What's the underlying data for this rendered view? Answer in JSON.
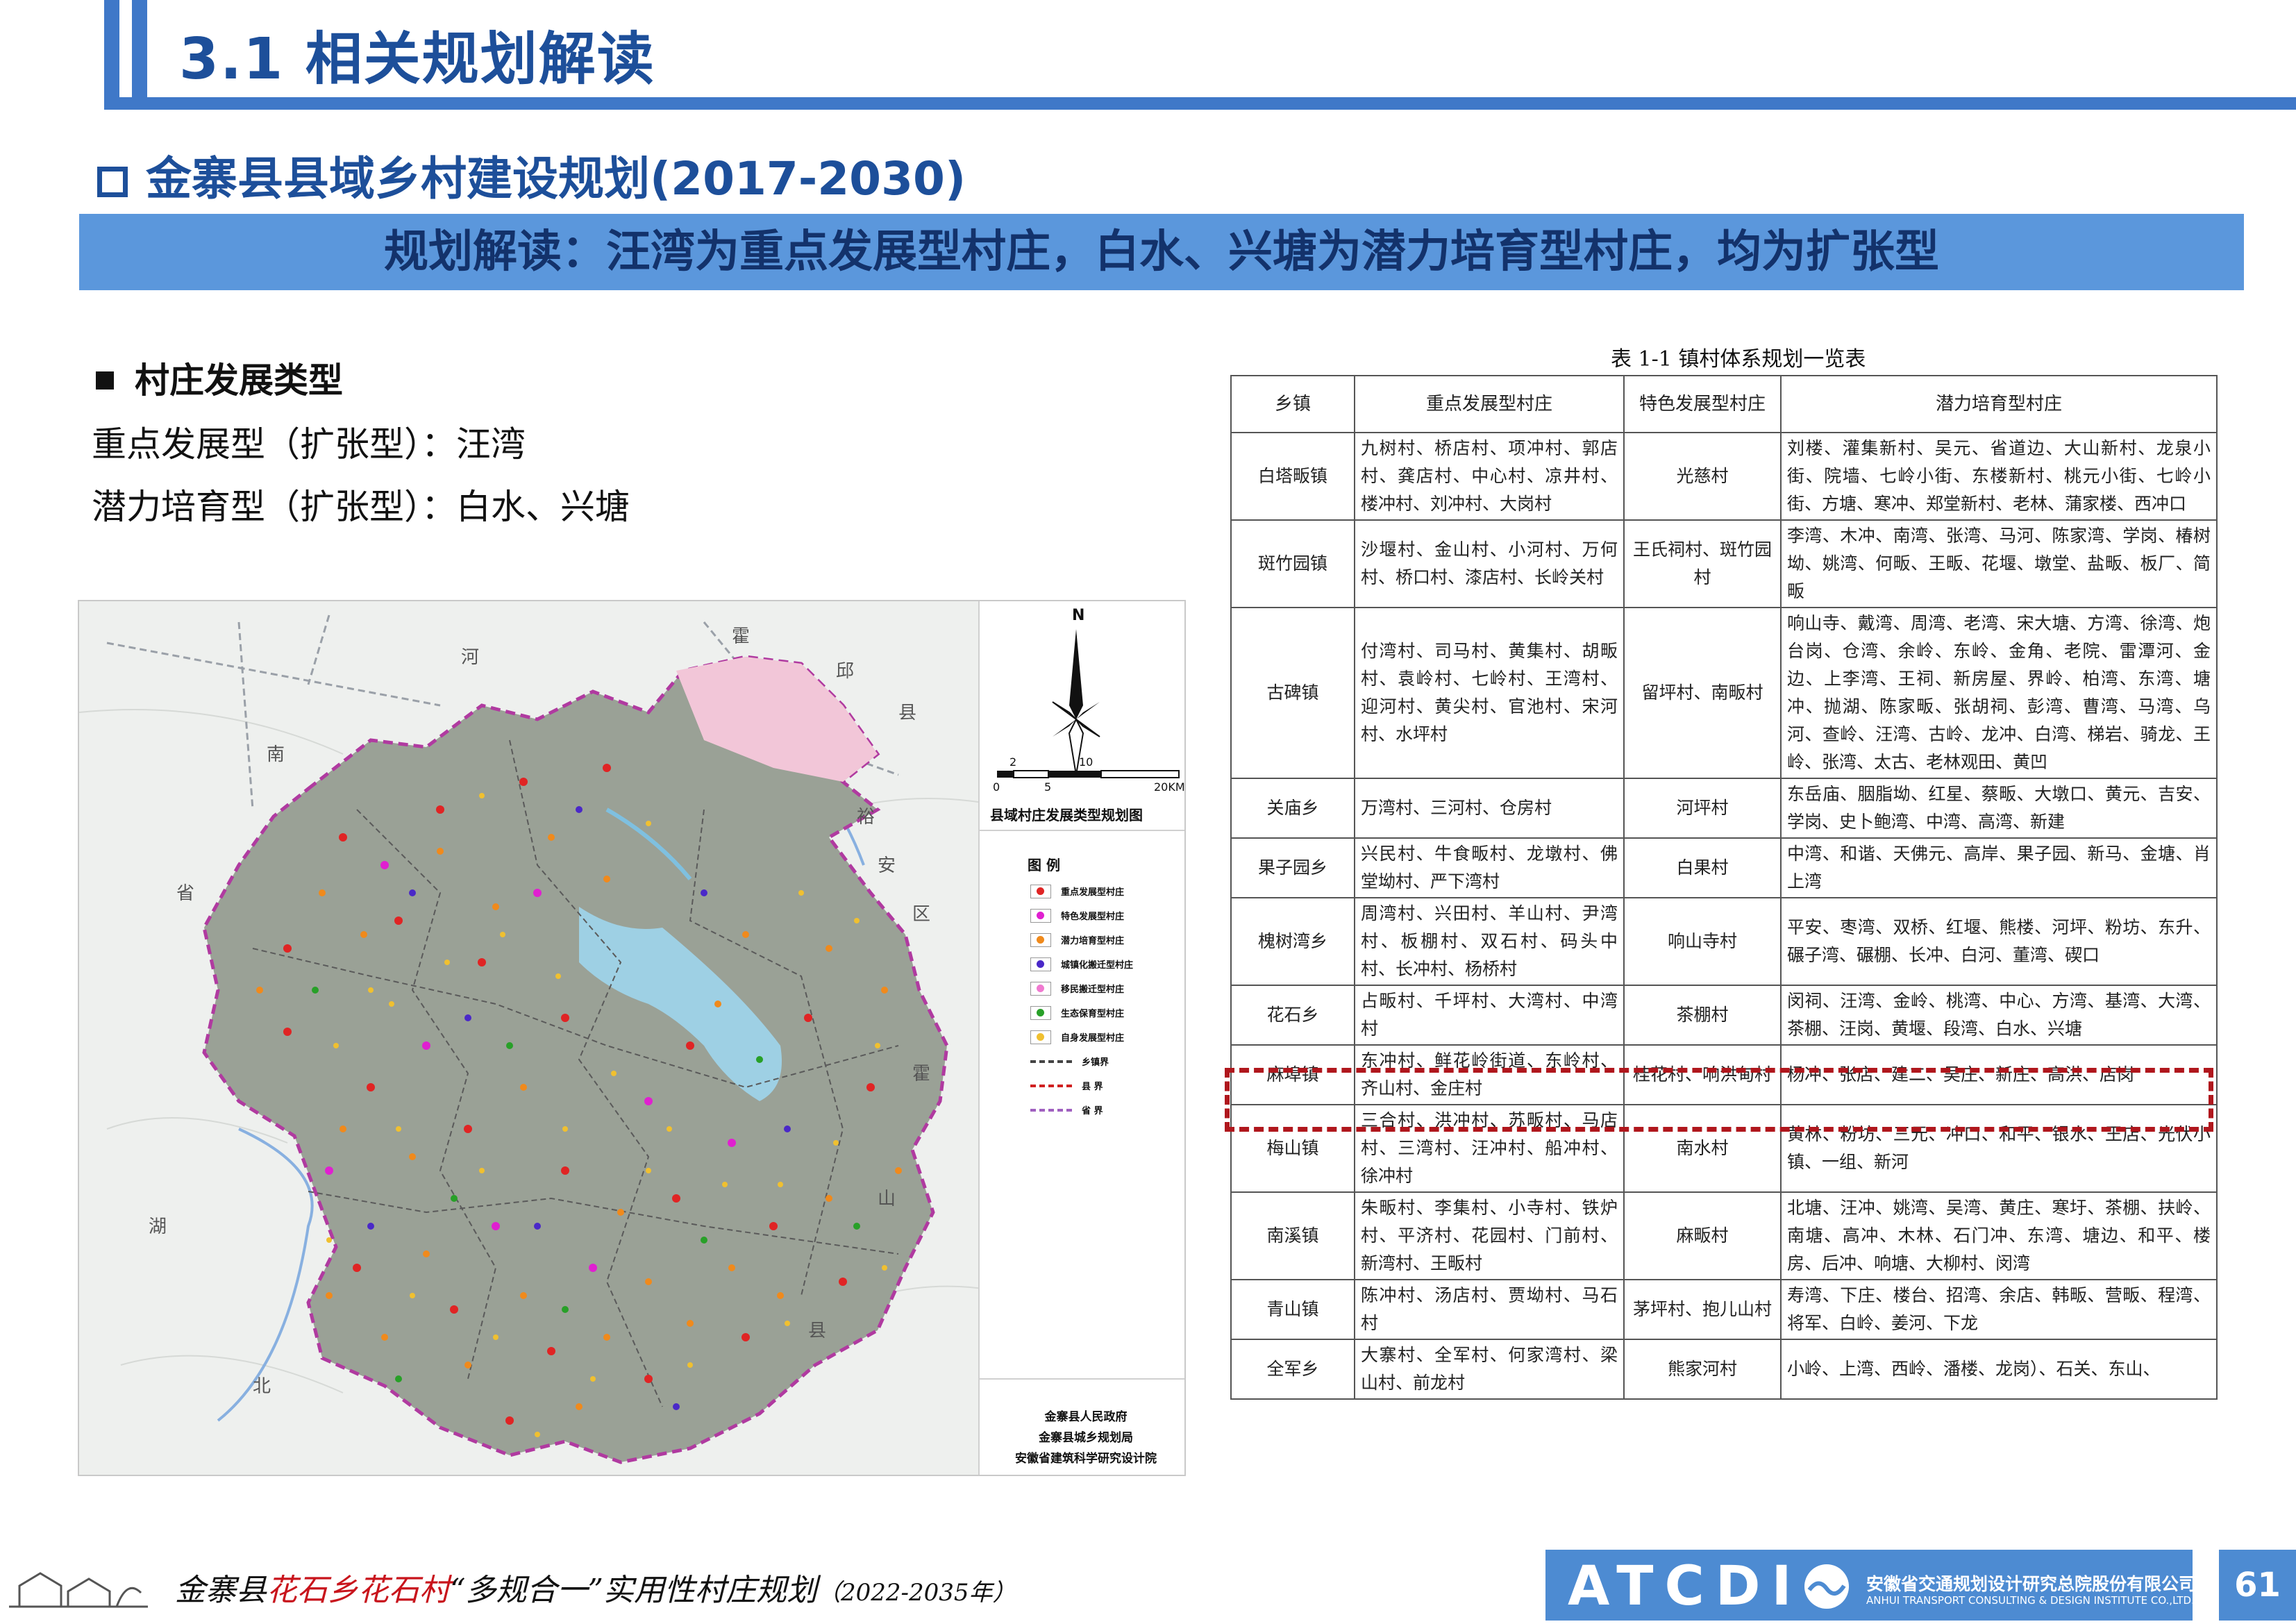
{
  "header": {
    "title": "3.1 相关规划解读"
  },
  "section": {
    "title": "金寨县县域乡村建设规划(2017-2030)",
    "banner": "规划解读：汪湾为重点发展型村庄，白水、兴塘为潜力培育型村庄，均为扩张型"
  },
  "village_types": {
    "heading": "村庄发展类型",
    "line1": "重点发展型（扩张型）：汪湾",
    "line2": "潜力培育型（扩张型）：白水、兴塘"
  },
  "map": {
    "title": "县域村庄发展类型规划图",
    "north": "N",
    "scale": {
      "t2": "2",
      "t10": "10",
      "t0": "0",
      "t5": "5",
      "t20": "20KM"
    },
    "legend_title": "图  例",
    "legend": [
      {
        "label": "重点发展型村庄",
        "color": "#e02424",
        "kind": "dot"
      },
      {
        "label": "特色发展型村庄",
        "color": "#e020d0",
        "kind": "dot"
      },
      {
        "label": "潜力培育型村庄",
        "color": "#f08a1c",
        "kind": "dot"
      },
      {
        "label": "城镇化搬迁型村庄",
        "color": "#4a28c8",
        "kind": "dot"
      },
      {
        "label": "移民搬迁型村庄",
        "color": "#f07ad0",
        "kind": "dot"
      },
      {
        "label": "生态保育型村庄",
        "color": "#28a028",
        "kind": "dot"
      },
      {
        "label": "自身发展型村庄",
        "color": "#f0c030",
        "kind": "dot"
      },
      {
        "label": "乡镇界",
        "color": "#444444",
        "kind": "line"
      },
      {
        "label": "县  界",
        "color": "#d02020",
        "kind": "line"
      },
      {
        "label": "省  界",
        "color": "#a060c0",
        "kind": "line"
      }
    ],
    "labels": {
      "he": "河",
      "huo1": "霍",
      "qiu": "邱",
      "xian1": "县",
      "nan": "南",
      "yu": "裕",
      "an": "安",
      "qu": "区",
      "sheng": "省",
      "huo2": "霍",
      "shan": "山",
      "xian2": "县",
      "hu": "湖",
      "bei": "北"
    },
    "credits": [
      "金寨县人民政府",
      "金寨县城乡规划局",
      "安徽省建筑科学研究设计院"
    ]
  },
  "table": {
    "caption": "表 1-1 镇村体系规划一览表",
    "headers": [
      "乡镇",
      "重点发展型村庄",
      "特色发展型村庄",
      "潜力培育型村庄"
    ],
    "rows": [
      [
        "白塔畈镇",
        "九树村、桥店村、项冲村、郭店村、龚店村、中心村、凉井村、楼冲村、刘冲村、大岗村",
        "光慈村",
        "刘楼、灌集新村、吴元、省道边、大山新村、龙泉小街、院墙、七岭小街、东楼新村、桃元小街、七岭小街、方塘、寒冲、郑堂新村、老林、蒲家楼、西冲口"
      ],
      [
        "斑竹园镇",
        "沙堰村、金山村、小河村、万何村、桥口村、漆店村、长岭关村",
        "王氏祠村、斑竹园村",
        "李湾、木冲、南湾、张湾、马河、陈家湾、学岗、椿树坳、姚湾、何畈、王畈、花堰、墩堂、盐畈、板厂、简畈"
      ],
      [
        "古碑镇",
        "付湾村、司马村、黄集村、胡畈村、袁岭村、七岭村、王湾村、迎河村、黄尖村、官池村、宋河村、水坪村",
        "留坪村、南畈村",
        "响山寺、戴湾、周湾、老湾、宋大塘、方湾、徐湾、炮台岗、仓湾、余岭、东岭、金角、老院、雷潭河、金边、上李湾、王祠、新房屋、界岭、柏湾、东湾、塘冲、抛湖、陈家畈、张胡祠、彭湾、曹湾、马湾、乌河、查岭、汪湾、古岭、龙冲、白湾、梯岩、骑龙、王岭、张湾、太古、老林观田、黄凹"
      ],
      [
        "关庙乡",
        "万湾村、三河村、仓房村",
        "河坪村",
        "东岳庙、胭脂坳、红星、蔡畈、大墩口、黄元、吉安、学岗、史卜鲍湾、中湾、高湾、新建"
      ],
      [
        "果子园乡",
        "兴民村、牛食畈村、龙墩村、佛堂坳村、严下湾村",
        "白果村",
        "中湾、和谐、天佛元、高岸、果子园、新马、金塘、肖上湾"
      ],
      [
        "槐树湾乡",
        "周湾村、兴田村、羊山村、尹湾村、板棚村、双石村、码头中村、长冲村、杨桥村",
        "响山寺村",
        "平安、枣湾、双桥、红堰、熊楼、河坪、粉坊、东升、碾子湾、碾棚、长冲、白河、董湾、碶口"
      ],
      [
        "花石乡",
        "占畈村、千坪村、大湾村、中湾村",
        "茶棚村",
        "闵祠、汪湾、金岭、桃湾、中心、方湾、基湾、大湾、茶棚、汪岗、黄堰、段湾、白水、兴塘"
      ],
      [
        "麻埠镇",
        "东冲村、鲜花岭街道、东岭村、齐山村、金庄村",
        "桂花村、响洪甸村",
        "杨冲、张店、建二、吴庄、新庄、高洪、店岗"
      ],
      [
        "梅山镇",
        "三合村、洪冲村、苏畈村、马店村、三湾村、汪冲村、船冲村、徐冲村",
        "南水村",
        "黄林、粉坊、三元、冲口、和平、银水、王店、光伏小镇、一组、新河"
      ],
      [
        "南溪镇",
        "朱畈村、李集村、小寺村、铁炉村、平济村、花园村、门前村、新湾村、王畈村",
        "麻畈村",
        "北塘、汪冲、姚湾、吴湾、黄庄、寒圩、茶棚、扶岭、南塘、高冲、木林、石门冲、东湾、塘边、和平、楼房、后冲、响塘、大柳村、闵湾"
      ],
      [
        "青山镇",
        "陈冲村、汤店村、贾坳村、马石村",
        "茅坪村、抱儿山村",
        "寿湾、下庄、楼台、招湾、余店、韩畈、营畈、程湾、将军、白岭、姜河、下龙"
      ],
      [
        "全军乡",
        "大寨村、全军村、何家湾村、梁山村、前龙村",
        "熊家河村",
        "小岭、上湾、西岭、潘楼、龙岗）、石关、东山、"
      ]
    ]
  },
  "footer": {
    "part1": "金寨县",
    "part2": "花石乡花石村",
    "part3": "“多规合一”实用性村庄规划",
    "part4": "（2022-2035年）",
    "logo": "ATCDI",
    "company_cn": "安徽省交通规划设计研究总院股份有限公司",
    "company_en": "ANHUI TRANSPORT CONSULTING & DESIGN INSTITUTE CO.,LTD.",
    "page": "61"
  }
}
